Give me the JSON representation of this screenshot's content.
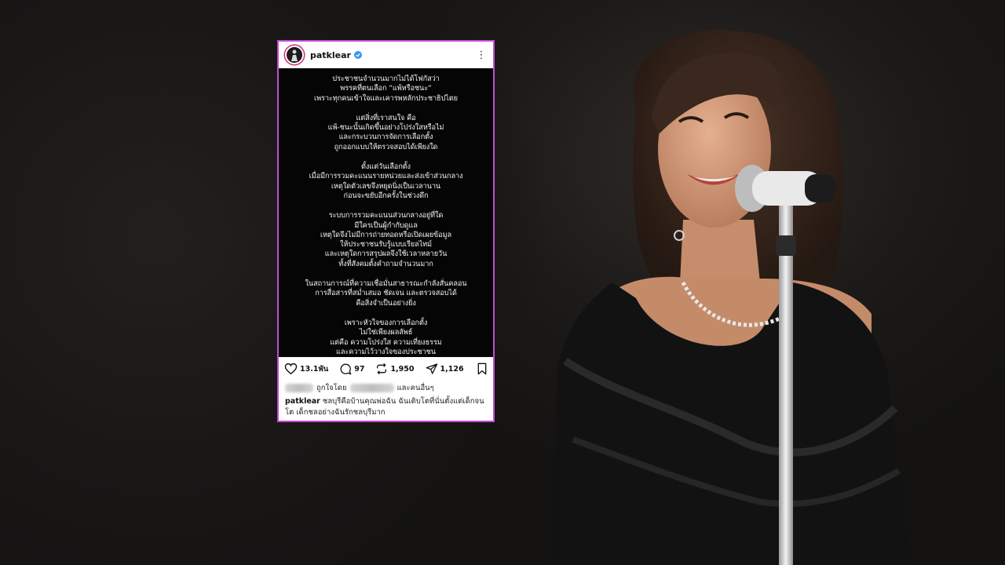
{
  "post": {
    "username": "patklear",
    "menu_icon": "more-vertical-icon",
    "paragraphs": [
      [
        "ประชาชนจำนวนมากไม่ได้โฟกัสว่า",
        "พรรคที่ตนเลือก “แพ้หรือชนะ”",
        "เพราะทุกคนเข้าใจและเคารพหลักประชาธิปไตย"
      ],
      [
        "แต่สิ่งที่เราสนใจ คือ",
        "แพ้-ชนะนั้นเกิดขึ้นอย่างโปร่งใสหรือไม่",
        "และกระบวนการจัดการเลือกตั้ง",
        "ถูกออกแบบให้ตรวจสอบได้เพียงใด"
      ],
      [
        "ตั้งแต่วันเลือกตั้ง",
        "เมื่อมีการรวมคะแนนรายหน่วยและส่งเข้าส่วนกลาง",
        "เหตุใดตัวเลขจึงหยุดนิ่งเป็นเวลานาน",
        "ก่อนจะขยับอีกครั้งในช่วงดึก"
      ],
      [
        "ระบบการรวมคะแนนส่วนกลางอยู่ที่ใด",
        "มีใครเป็นผู้กำกับดูแล",
        "เหตุใดจึงไม่มีการถ่ายทอดหรือเปิดเผยข้อมูล",
        "ให้ประชาชนรับรู้แบบเรียลไทม์",
        "และเหตุใดการสรุปผลจึงใช้เวลาหลายวัน",
        "ทั้งที่สังคมตั้งคำถามจำนวนมาก"
      ],
      [
        "ในสถานการณ์ที่ความเชื่อมั่นสาธารณะกำลังสั่นคลอน",
        "การสื่อสารที่สม่ำเสมอ ชัดเจน และตรวจสอบได้",
        "คือสิ่งจำเป็นอย่างยิ่ง"
      ],
      [
        "เพราะหัวใจของการเลือกตั้ง",
        "ไม่ใช่เพียงผลลัพธ์",
        "แต่คือ ความโปร่งใส ความเที่ยงธรรม",
        "และความไว้วางใจของประชาชน"
      ]
    ],
    "stats": {
      "likes": "13.1พัน",
      "comments": "97",
      "reposts": "1,950",
      "shares": "1,126"
    },
    "liked_by_prefix": "ถูกใจโดย",
    "liked_by_suffix": "และคนอื่นๆ",
    "caption_user": "patklear",
    "caption_text": "ชลบุรีคือบ้านคุณพ่อฉัน ฉันเติบโตที่นั่นตั้งแต่เด็กจนโต เด็กชลอย่างฉันรักชลบุรีมาก"
  },
  "colors": {
    "card_border": "#c24bd6",
    "verified": "#3797f0",
    "post_background": "#050505"
  }
}
